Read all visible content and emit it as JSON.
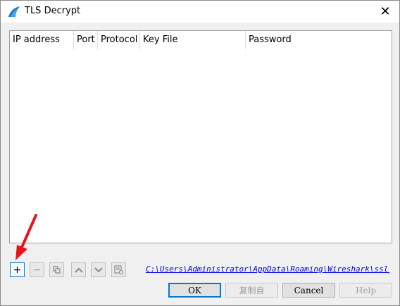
{
  "window": {
    "title": "TLS Decrypt",
    "app_icon": "wireshark-fin-icon",
    "close_glyph": "✕"
  },
  "table": {
    "columns": [
      "IP address",
      "Port",
      "Protocol",
      "Key File",
      "Password"
    ],
    "rows": []
  },
  "toolbar": {
    "add_glyph": "+",
    "remove_glyph": "−",
    "copy_icon": "copy-icon",
    "move_up_icon": "chevron-up-icon",
    "move_down_icon": "chevron-down-icon",
    "clear_icon": "clear-list-icon"
  },
  "file_path": "C:\\Users\\Administrator\\AppData\\Roaming\\Wireshark\\ssl_keys",
  "buttons": {
    "ok": "OK",
    "copy_from": "复制自",
    "cancel": "Cancel",
    "help": "Help"
  },
  "colors": {
    "accent": "#0078d7",
    "annotation_arrow": "#e8141d",
    "link": "#0000ee"
  }
}
